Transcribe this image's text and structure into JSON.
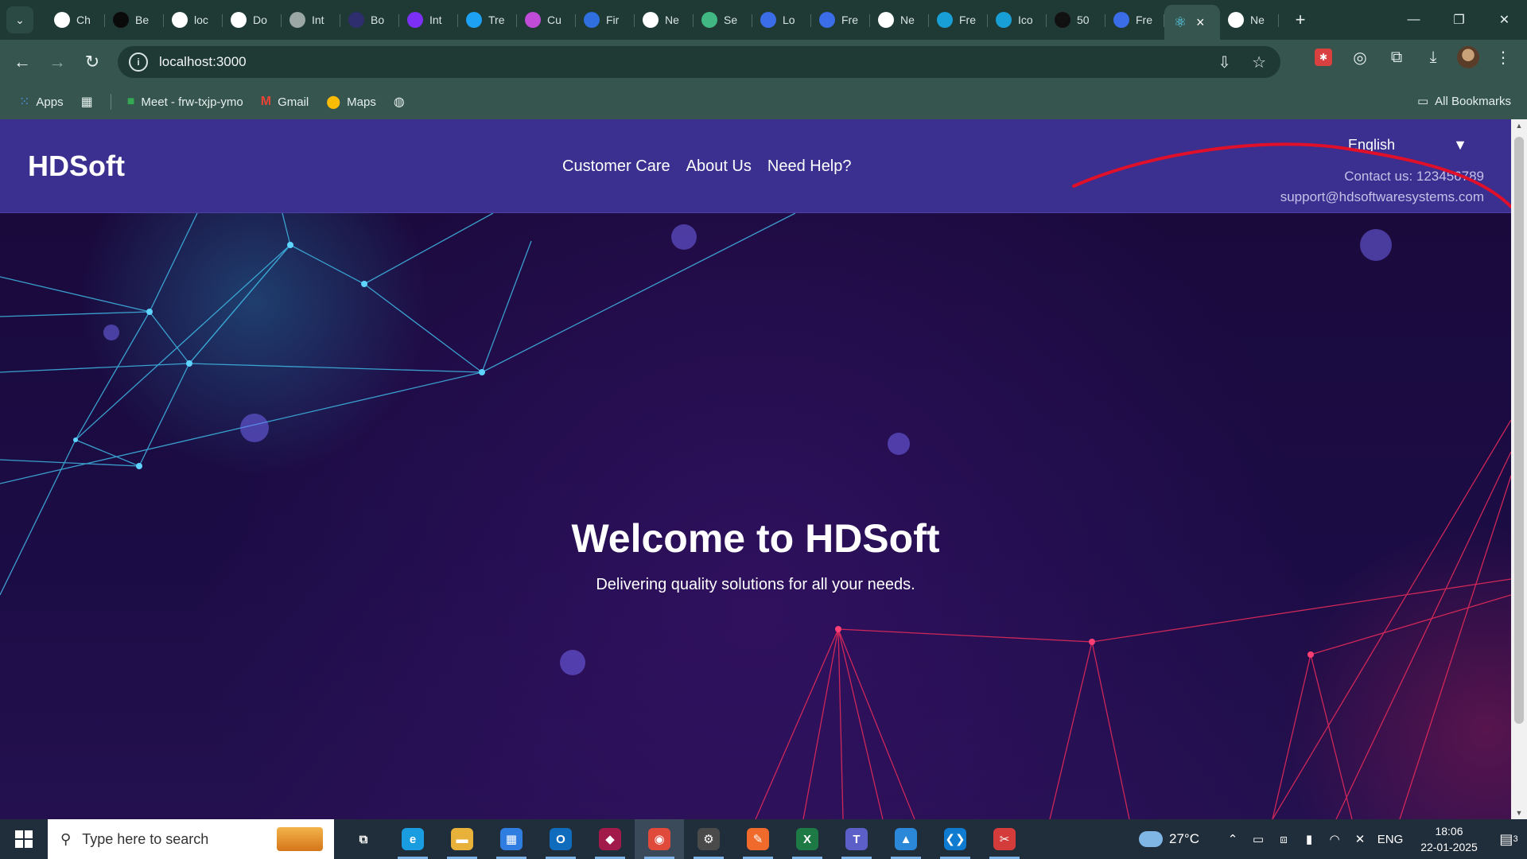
{
  "browser": {
    "tabs": [
      {
        "label": "Ch",
        "icon": "openai-icon",
        "color": "#ffffff"
      },
      {
        "label": "Be",
        "icon": "jf-icon",
        "color": "#0a0a0a"
      },
      {
        "label": "loc",
        "icon": "stack-icon",
        "color": "#ffffff"
      },
      {
        "label": "Do",
        "icon": "download-icon",
        "color": "#ffffff"
      },
      {
        "label": "Int",
        "icon": "globe-icon",
        "color": "#9aa7a4"
      },
      {
        "label": "Bo",
        "icon": "code-icon",
        "color": "#2e2e6e"
      },
      {
        "label": "Int",
        "icon": "bootstrap-icon",
        "color": "#7b2ff7"
      },
      {
        "label": "Tre",
        "icon": "c-icon",
        "color": "#1da1f2"
      },
      {
        "label": "Cu",
        "icon": "m-icon",
        "color": "#c04bd6"
      },
      {
        "label": "Fir",
        "icon": "flag-icon",
        "color": "#2f6fe0"
      },
      {
        "label": "Ne",
        "icon": "chatgpt-icon",
        "color": "#ffffff"
      },
      {
        "label": "Se",
        "icon": "vue-icon",
        "color": "#41b883"
      },
      {
        "label": "Lo",
        "icon": "f-icon",
        "color": "#3b6de8"
      },
      {
        "label": "Fre",
        "icon": "f-icon",
        "color": "#3b6de8"
      },
      {
        "label": "Ne",
        "icon": "chatgpt-icon",
        "color": "#ffffff"
      },
      {
        "label": "Fre",
        "icon": "search-icon",
        "color": "#18a0d6"
      },
      {
        "label": "Ico",
        "icon": "search-icon",
        "color": "#18a0d6"
      },
      {
        "label": "50",
        "icon": "figure-icon",
        "color": "#111111"
      },
      {
        "label": "Fre",
        "icon": "f-icon",
        "color": "#3b6de8"
      }
    ],
    "active_tab": {
      "icon": "react-icon",
      "color": "#61dafb"
    },
    "last_tab": {
      "label": "Ne",
      "icon": "chatgpt-icon"
    },
    "url": "localhost:3000",
    "bookmarks": [
      {
        "label": "Apps",
        "icon": "apps-grid-icon"
      },
      {
        "label": "",
        "icon": "tab-groups-icon"
      },
      {
        "label": "Meet - frw-txjp-ymo",
        "icon": "meet-icon"
      },
      {
        "label": "Gmail",
        "icon": "gmail-icon"
      },
      {
        "label": "Maps",
        "icon": "maps-icon"
      },
      {
        "label": "",
        "icon": "globe-icon"
      }
    ],
    "all_bookmarks": "All Bookmarks"
  },
  "site": {
    "logo": "HDSoft",
    "nav": [
      "Customer Care",
      "About Us",
      "Need Help?"
    ],
    "language": "English",
    "language_caret": "▼",
    "contact_phone": "Contact us: 123456789",
    "contact_email": "support@hdsoftwaresystems.com",
    "hero_title": "Welcome to HDSoft",
    "hero_subtitle": "Delivering quality solutions for all your needs.",
    "colors": {
      "header": "#3b2f8f",
      "hero": "#1a0a3c",
      "annotation": "#e0102a"
    }
  },
  "taskbar": {
    "search_placeholder": "Type here to search",
    "apps": [
      {
        "name": "task-view",
        "glyph": "⧉",
        "color": "#202d3a"
      },
      {
        "name": "edge",
        "glyph": "e",
        "color": "#1a9ce0"
      },
      {
        "name": "file-explorer",
        "glyph": "▬",
        "color": "#e8b23a"
      },
      {
        "name": "store",
        "glyph": "▦",
        "color": "#2f7de1"
      },
      {
        "name": "outlook",
        "glyph": "O",
        "color": "#0f6cbd"
      },
      {
        "name": "app-red",
        "glyph": "◆",
        "color": "#a21a4a"
      },
      {
        "name": "chrome",
        "glyph": "◉",
        "color": "#e04a3a"
      },
      {
        "name": "settings-gear",
        "glyph": "⚙",
        "color": "#4a4a4a"
      },
      {
        "name": "postman",
        "glyph": "✎",
        "color": "#ef6a2b"
      },
      {
        "name": "excel",
        "glyph": "X",
        "color": "#1d7a45"
      },
      {
        "name": "teams",
        "glyph": "T",
        "color": "#5b5fc7"
      },
      {
        "name": "photos",
        "glyph": "▲",
        "color": "#2b88d8"
      },
      {
        "name": "vscode",
        "glyph": "❮❯",
        "color": "#0e7ad0"
      },
      {
        "name": "snipping",
        "glyph": "✂",
        "color": "#d43c3c"
      }
    ],
    "weather": "27°C",
    "lang": "ENG",
    "time": "18:06",
    "date": "22-01-2025",
    "notifications": "3"
  }
}
